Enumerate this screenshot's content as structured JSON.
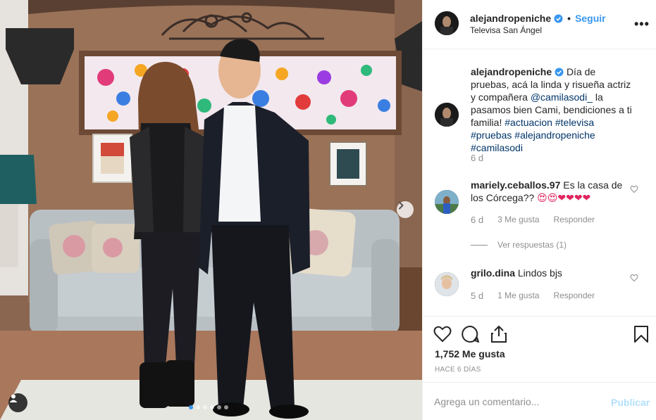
{
  "post": {
    "carousel_total": 6,
    "carousel_active": 0
  },
  "header": {
    "username": "alejandropeniche",
    "separator": "•",
    "follow_label": "Seguir",
    "location": "Televisa San Ángel",
    "more_icon": "more-horizontal-icon",
    "more_glyph": "•••"
  },
  "caption": {
    "username": "alejandropeniche",
    "text_1": "Día de pruebas, acá la linda y risueña actriz y compañera ",
    "mention": "@camilasodi_",
    "text_2": " la pasamos bien Cami, bendiciones a ti familia!",
    "hashtags": [
      "#actuacion",
      "#televisa",
      "#pruebas",
      "#alejandropeniche",
      "#camilasodi"
    ],
    "time": "6 d"
  },
  "comments": [
    {
      "username": "mariely.ceballos.97",
      "text": "Es la casa de los Córcega??",
      "emoji": "😍😍❤❤❤❤",
      "time": "6 d",
      "likes": "3 Me gusta",
      "reply": "Responder"
    },
    {
      "username": "grilo.dina",
      "text": "Lindos bjs",
      "time": "5 d",
      "likes": "1 Me gusta",
      "reply": "Responder"
    }
  ],
  "view_replies": "Ver respuestas (1)",
  "actions": {
    "likes_count": "1,752 Me gusta",
    "date": "HACE 6 DÍAS"
  },
  "comment_box": {
    "placeholder": "Agrega un comentario...",
    "publish_label": "Publicar"
  },
  "colors": {
    "accent": "#3897f0",
    "link": "#003569",
    "muted": "#8e8e8e",
    "publish_disabled": "#b2dffc",
    "border": "#efefef"
  }
}
